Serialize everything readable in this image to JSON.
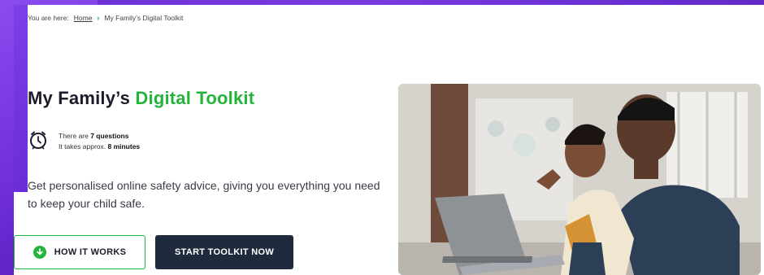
{
  "breadcrumb": {
    "prefix": "You are here:",
    "home": "Home",
    "current": "My Family’s Digital Toolkit"
  },
  "hero": {
    "title_main": "My Family’s ",
    "title_accent": "Digital Toolkit",
    "questions_prefix": "There are ",
    "questions_value": "7 questions",
    "time_prefix": "It takes approx. ",
    "time_value": "8 minutes",
    "description": "Get personalised online safety advice, giving you everything you need to keep your child safe."
  },
  "buttons": {
    "how_it_works": "HOW IT WORKS",
    "start_toolkit": "START TOOLKIT NOW"
  },
  "colors": {
    "accent_green": "#25b43b",
    "dark_button": "#1f2a3c",
    "background_purple": "#6a2fd6"
  }
}
